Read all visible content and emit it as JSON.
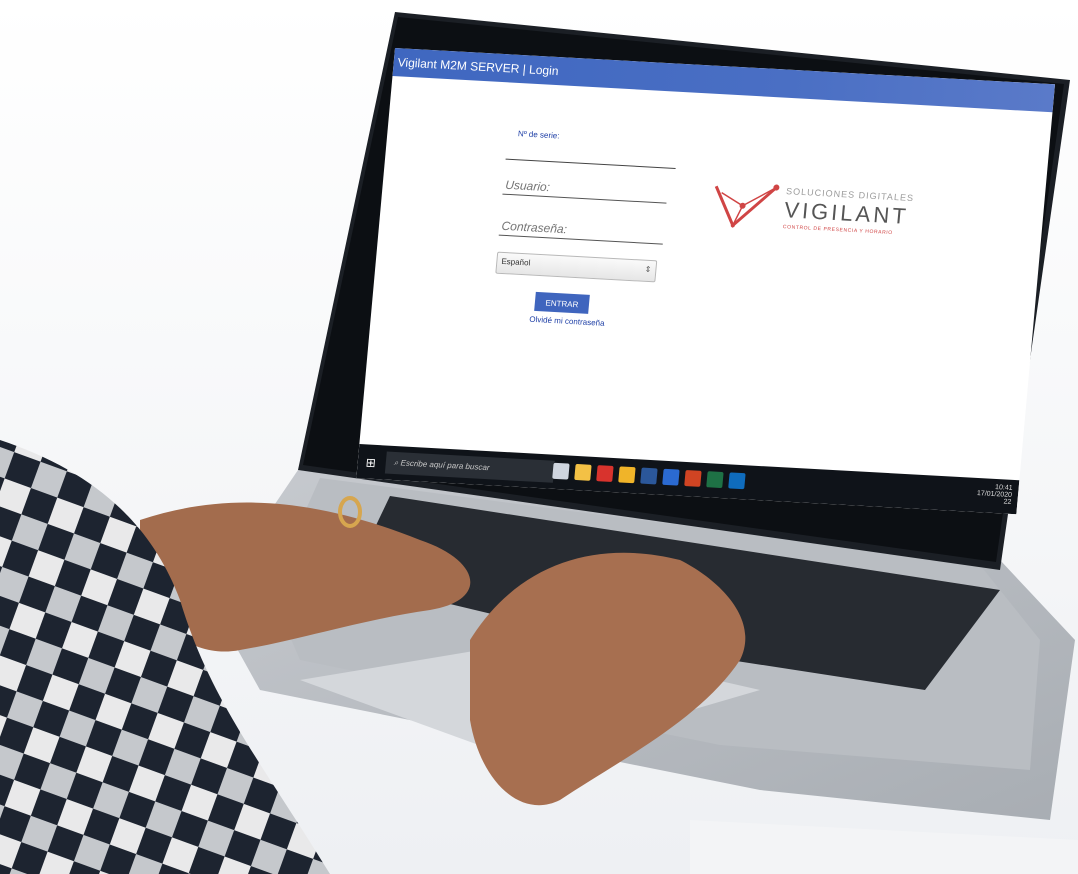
{
  "window": {
    "title": "Vigilant M2M SERVER | Login"
  },
  "form": {
    "serial_label": "Nº de serie:",
    "serial_value": "",
    "username_placeholder": "Usuario:",
    "password_placeholder": "Contraseña:",
    "language_value": "Español",
    "submit_label": "ENTRAR",
    "forgot_label": "Olvidé mi contraseña"
  },
  "logo": {
    "line1": "SOLUCIONES DIGITALES",
    "line2": "VIGILANT",
    "line3": "CONTROL DE PRESENCIA Y HORARIO"
  },
  "taskbar": {
    "search_placeholder": "Escribe aquí para buscar",
    "clock_time": "10:41",
    "clock_date": "17/01/2020",
    "notification_count": "22",
    "app_icons": [
      "task-view-icon",
      "file-explorer-icon",
      "pdf-icon",
      "chrome-icon",
      "vs-icon",
      "word-icon",
      "powerpoint-icon",
      "excel-icon",
      "outlook-icon"
    ]
  },
  "colors": {
    "titlebar": "#4468c2",
    "button": "#3f65be",
    "logo_red": "#d04545",
    "taskbar": "#0f1319"
  }
}
